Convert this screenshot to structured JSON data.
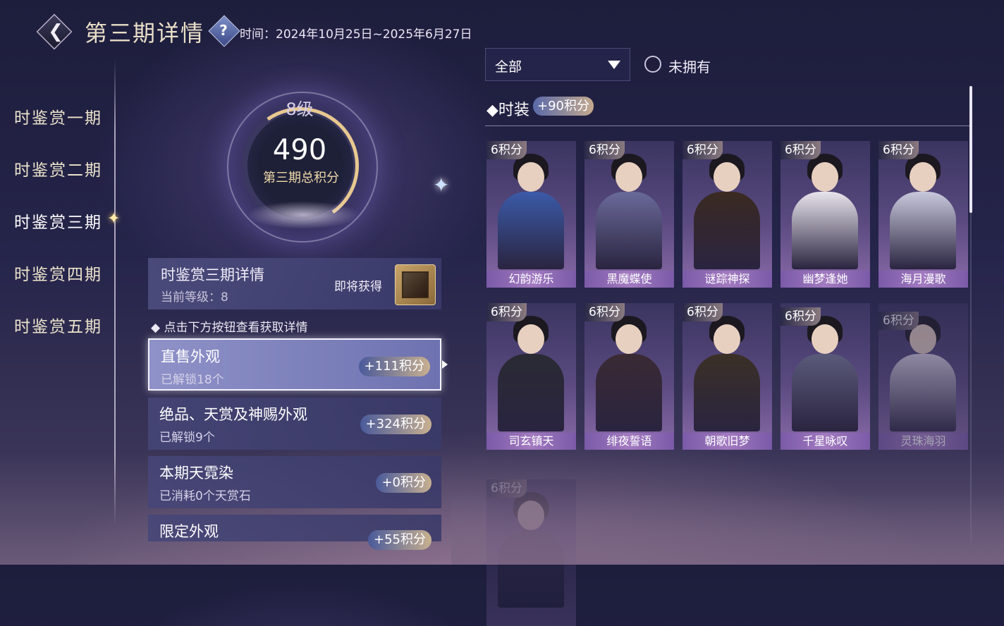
{
  "header": {
    "title": "第三期详情",
    "time": "时间：2024年10月25日~2025年6月27日",
    "help_icon": "help-icon",
    "back_icon": "back-icon"
  },
  "nav": {
    "items": [
      {
        "label": "时鉴赏一期",
        "active": false
      },
      {
        "label": "时鉴赏二期",
        "active": false
      },
      {
        "label": "时鉴赏三期",
        "active": true
      },
      {
        "label": "时鉴赏四期",
        "active": false
      },
      {
        "label": "时鉴赏五期",
        "active": false
      }
    ]
  },
  "ring": {
    "level": "8级",
    "score": "490",
    "score_label": "第三期总积分"
  },
  "detail": {
    "title": "时鉴赏三期详情",
    "current_level": "当前等级：8",
    "soon_label": "即将获得"
  },
  "hint": "点击下方按钮查看获取详情",
  "categories": [
    {
      "title": "直售外观",
      "sub": "已解锁18个",
      "points": "+111积分",
      "active": true
    },
    {
      "title": "绝品、天赏及神赐外观",
      "sub": "已解锁9个",
      "points": "+324积分",
      "active": false
    },
    {
      "title": "本期天霓染",
      "sub": "已消耗0个天赏石",
      "points": "+0积分",
      "active": false
    },
    {
      "title": "限定外观",
      "sub": "",
      "points": "+55积分",
      "active": false
    }
  ],
  "filter": {
    "selected": "全部",
    "toggle_label": "未拥有"
  },
  "section": {
    "title": "时装",
    "points": "+90积分"
  },
  "items": [
    {
      "badge": "6积分",
      "name": "幻韵游乐",
      "color": "#3b5aa8"
    },
    {
      "badge": "6积分",
      "name": "黑魔蝶使",
      "color": "#6a6a9a"
    },
    {
      "badge": "6积分",
      "name": "谜踪神探",
      "color": "#3a2a22"
    },
    {
      "badge": "6积分",
      "name": "幽梦逢她",
      "color": "#e8e4ec"
    },
    {
      "badge": "6积分",
      "name": "海月漫歌",
      "color": "#c8c8dc"
    },
    {
      "badge": "6积分",
      "name": "司玄镇天",
      "color": "#2a2a34"
    },
    {
      "badge": "6积分",
      "name": "绯夜誓语",
      "color": "#3a2a34"
    },
    {
      "badge": "6积分",
      "name": "朝歌旧梦",
      "color": "#3a3026"
    },
    {
      "badge": "6积分",
      "name": "千星咏叹",
      "color": "#5a5a7a"
    },
    {
      "badge": "6积分",
      "name": "灵珠海羽",
      "color": "#dcd4e4"
    },
    {
      "badge": "6积分",
      "name": "",
      "color": "#4a4060"
    }
  ]
}
